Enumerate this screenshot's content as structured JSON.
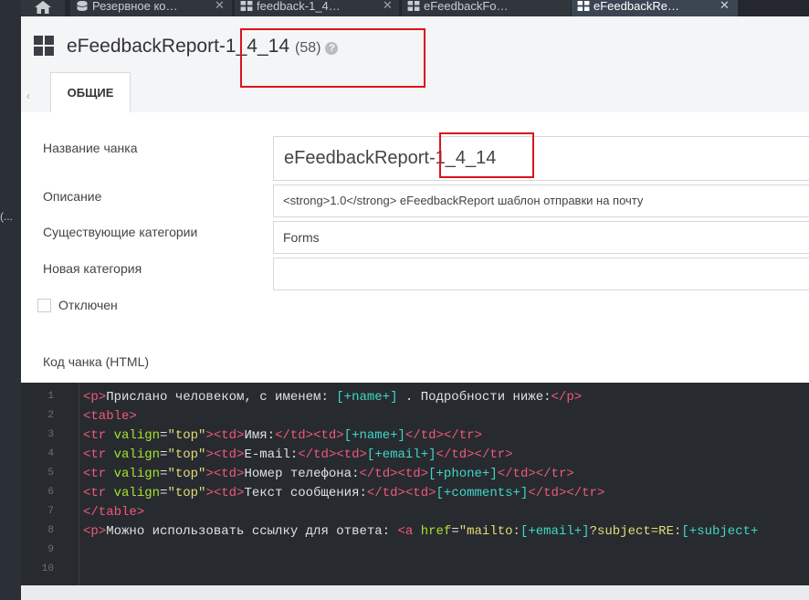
{
  "sidebar_left": {
    "text": "(..."
  },
  "tabs": [
    {
      "label": "Резервное ко…",
      "icon": "database-icon"
    },
    {
      "label": "feedback-1_4…",
      "icon": "grid-icon"
    },
    {
      "label": "eFeedbackFo…",
      "icon": "grid-icon"
    },
    {
      "label": "eFeedbackRe…",
      "icon": "grid-icon",
      "active": true
    }
  ],
  "header": {
    "title": "eFeedbackReport-1_4_14",
    "count": "(58)",
    "help": "?",
    "collapse": "‹",
    "tab_general": "ОБЩИЕ"
  },
  "form": {
    "name_label": "Название чанка",
    "name_value": "eFeedbackReport-1_4_14",
    "desc_label": "Описание",
    "desc_value": "<strong>1.0</strong> eFeedbackReport  шаблон отправки на почту",
    "cat_label": "Существующие категории",
    "cat_value": "Forms",
    "newcat_label": "Новая категория",
    "newcat_value": "",
    "disabled_label": "Отключен",
    "code_label": "Код чанка (HTML)"
  },
  "code": {
    "line_numbers": [
      "1",
      "2",
      "3",
      "4",
      "5",
      "6",
      "7",
      "8",
      "9",
      "10"
    ],
    "l1": [
      "<p>",
      "Прислано человеком, с именем: ",
      "[+name+]",
      " . Подробности ниже:",
      "</p>"
    ],
    "l2": [
      "<table>"
    ],
    "l3": [
      "<tr",
      " valign",
      "=",
      "\"top\"",
      "><td>",
      "Имя:",
      "</td><td>",
      "[+name+]",
      "</td></tr>"
    ],
    "l4": [
      "<tr",
      " valign",
      "=",
      "\"top\"",
      "><td>",
      "E-mail:",
      "</td><td>",
      "[+email+]",
      "</td></tr>"
    ],
    "l5": [
      "<tr",
      " valign",
      "=",
      "\"top\"",
      "><td>",
      "Номер телефона:",
      "</td><td>",
      "[+phone+]",
      "</td></tr>"
    ],
    "l6": [
      "<tr",
      " valign",
      "=",
      "\"top\"",
      "><td>",
      "Текст сообщения:",
      "</td><td>",
      "[+comments+]",
      "</td></tr>"
    ],
    "l7": [
      "</table>"
    ],
    "l8": [
      "<p>",
      "Можно использовать ссылку для ответа: ",
      "<a",
      " href",
      "=",
      "\"mailto:",
      "[+email+]",
      "?subject=RE:",
      "[+subject+"
    ]
  },
  "colors": {
    "tag": "#f0597a",
    "attr": "#a6e22e",
    "string": "#e6db74",
    "placeholder": "#40d6c5",
    "highlight": "#d9141d"
  }
}
